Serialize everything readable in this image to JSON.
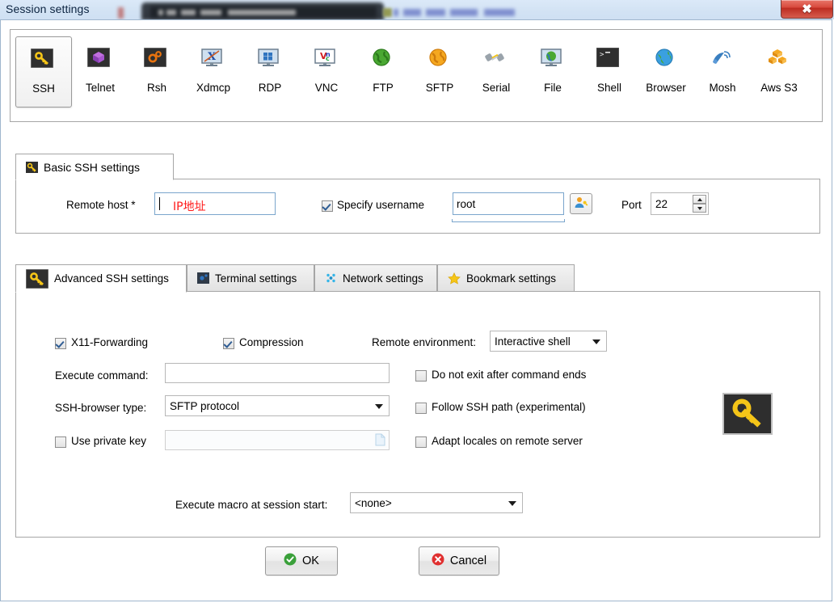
{
  "window": {
    "title": "Session settings",
    "close_label": "✖"
  },
  "session_types": [
    {
      "label": "SSH",
      "icon": "ssh-key-icon",
      "selected": true
    },
    {
      "label": "Telnet",
      "icon": "telnet-cube-icon",
      "selected": false
    },
    {
      "label": "Rsh",
      "icon": "rsh-gears-icon",
      "selected": false
    },
    {
      "label": "Xdmcp",
      "icon": "xdmcp-monitor-icon",
      "selected": false
    },
    {
      "label": "RDP",
      "icon": "rdp-monitor-icon",
      "selected": false
    },
    {
      "label": "VNC",
      "icon": "vnc-monitor-icon",
      "selected": false
    },
    {
      "label": "FTP",
      "icon": "ftp-globe-icon",
      "selected": false
    },
    {
      "label": "SFTP",
      "icon": "sftp-globe-icon",
      "selected": false
    },
    {
      "label": "Serial",
      "icon": "serial-plug-icon",
      "selected": false
    },
    {
      "label": "File",
      "icon": "file-monitor-icon",
      "selected": false
    },
    {
      "label": "Shell",
      "icon": "shell-terminal-icon",
      "selected": false
    },
    {
      "label": "Browser",
      "icon": "browser-globe-icon",
      "selected": false
    },
    {
      "label": "Mosh",
      "icon": "mosh-satellite-icon",
      "selected": false
    },
    {
      "label": "Aws S3",
      "icon": "aws-s3-boxes-icon",
      "selected": false
    }
  ],
  "basic": {
    "tab_label": "Basic SSH settings",
    "tab_icon": "ssh-key-icon",
    "remote_host_label": "Remote host *",
    "remote_host_value": "",
    "remote_host_annotation": "IP地址",
    "specify_username_label": "Specify username",
    "specify_username_checked": true,
    "username_value": "root",
    "user_picker_icon": "user-key-icon",
    "port_label": "Port",
    "port_value": "22"
  },
  "advanced_tabs": [
    {
      "label": "Advanced SSH settings",
      "icon": "ssh-key-icon",
      "active": true
    },
    {
      "label": "Terminal settings",
      "icon": "terminal-icon",
      "active": false
    },
    {
      "label": "Network settings",
      "icon": "network-dots-icon",
      "active": false
    },
    {
      "label": "Bookmark settings",
      "icon": "star-icon",
      "active": false
    }
  ],
  "advanced": {
    "x11_label": "X11-Forwarding",
    "x11_checked": true,
    "compression_label": "Compression",
    "compression_checked": true,
    "remote_env_label": "Remote environment:",
    "remote_env_value": "Interactive shell",
    "execute_command_label": "Execute command:",
    "execute_command_value": "",
    "do_not_exit_label": "Do not exit after command ends",
    "do_not_exit_checked": false,
    "ssh_browser_label": "SSH-browser type:",
    "ssh_browser_value": "SFTP protocol",
    "follow_ssh_path_label": "Follow SSH path (experimental)",
    "follow_ssh_path_checked": false,
    "use_private_key_label": "Use private key",
    "use_private_key_checked": false,
    "private_key_value": "",
    "private_key_browse_icon": "file-browse-icon",
    "adapt_locales_label": "Adapt locales on remote server",
    "adapt_locales_checked": false,
    "big_key_icon": "key-icon",
    "macro_label": "Execute macro at session start:",
    "macro_value": "<none>"
  },
  "footer": {
    "ok_label": "OK",
    "cancel_label": "Cancel",
    "ok_icon": "check-circle-icon",
    "cancel_icon": "cross-circle-icon"
  },
  "colors": {
    "titlebar": "#d3e3f4",
    "close_red": "#d8483c",
    "accent_blue": "#7aa5cc",
    "annotation_red": "#ff1a1a",
    "key_yellow": "#f5c518",
    "ok_green": "#3aa03a",
    "cancel_red": "#e03030"
  }
}
